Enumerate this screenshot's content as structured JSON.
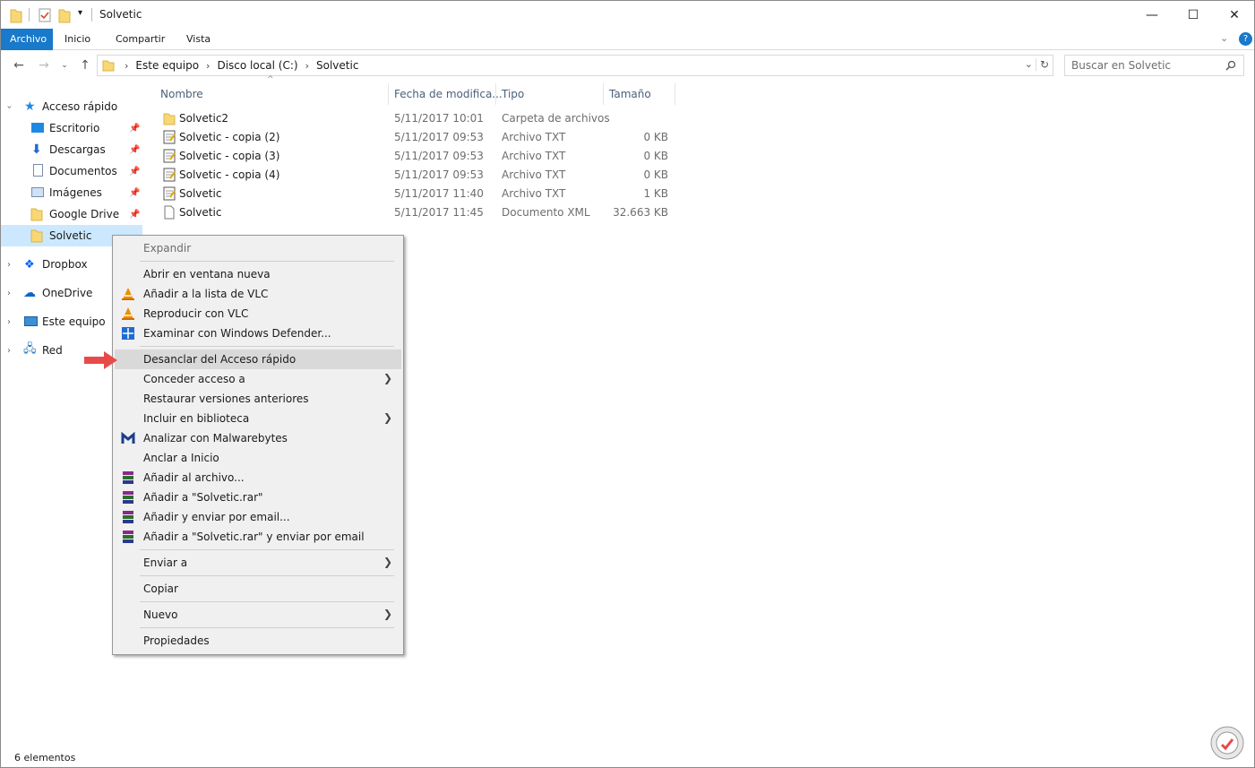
{
  "window": {
    "title": "Solvetic",
    "controls": {
      "minimize": "—",
      "maximize": "☐",
      "close": "✕"
    }
  },
  "ribbon": {
    "tabs": [
      "Archivo",
      "Inicio",
      "Compartir",
      "Vista"
    ],
    "expand_icon": "chevron-down-icon",
    "help_icon": "?"
  },
  "address": {
    "crumbs": [
      "Este equipo",
      "Disco local (C:)",
      "Solvetic"
    ],
    "search_placeholder": "Buscar en Solvetic"
  },
  "sidebar": {
    "items": [
      {
        "label": "Acceso rápido",
        "icon": "star-icon"
      },
      {
        "label": "Escritorio",
        "icon": "desktop-icon"
      },
      {
        "label": "Descargas",
        "icon": "download-icon"
      },
      {
        "label": "Documentos",
        "icon": "document-icon"
      },
      {
        "label": "Imágenes",
        "icon": "image-icon"
      },
      {
        "label": "Google Drive",
        "icon": "folder-icon"
      },
      {
        "label": "Solvetic",
        "icon": "folder-icon"
      },
      {
        "label": "Dropbox",
        "icon": "dropbox-icon"
      },
      {
        "label": "OneDrive",
        "icon": "cloud-icon"
      },
      {
        "label": "Este equipo",
        "icon": "computer-icon"
      },
      {
        "label": "Red",
        "icon": "network-icon"
      }
    ]
  },
  "columns": [
    "Nombre",
    "Fecha de modifica...",
    "Tipo",
    "Tamaño"
  ],
  "files": [
    {
      "name": "Solvetic2",
      "date": "5/11/2017 10:01",
      "type": "Carpeta de archivos",
      "size": "",
      "icon": "folder-icon"
    },
    {
      "name": "Solvetic - copia (2)",
      "date": "5/11/2017 09:53",
      "type": "Archivo TXT",
      "size": "0 KB",
      "icon": "text-file-icon"
    },
    {
      "name": "Solvetic - copia (3)",
      "date": "5/11/2017 09:53",
      "type": "Archivo TXT",
      "size": "0 KB",
      "icon": "text-file-icon"
    },
    {
      "name": "Solvetic - copia (4)",
      "date": "5/11/2017 09:53",
      "type": "Archivo TXT",
      "size": "0 KB",
      "icon": "text-file-icon"
    },
    {
      "name": "Solvetic",
      "date": "5/11/2017 11:40",
      "type": "Archivo TXT",
      "size": "1 KB",
      "icon": "text-file-icon"
    },
    {
      "name": "Solvetic",
      "date": "5/11/2017 11:45",
      "type": "Documento XML",
      "size": "32.663 KB",
      "icon": "blank-file-icon"
    }
  ],
  "context_menu": {
    "items": [
      {
        "label": "Expandir",
        "disabled": true
      },
      {
        "label": "Abrir en ventana nueva"
      },
      {
        "label": "Añadir a la lista de VLC",
        "icon": "vlc-icon"
      },
      {
        "label": "Reproducir con VLC",
        "icon": "vlc-icon"
      },
      {
        "label": "Examinar con Windows Defender...",
        "icon": "defender-icon"
      },
      {
        "label": "Desanclar del Acceso rápido",
        "highlighted": true
      },
      {
        "label": "Conceder acceso a",
        "submenu": true
      },
      {
        "label": "Restaurar versiones anteriores"
      },
      {
        "label": "Incluir en biblioteca",
        "submenu": true
      },
      {
        "label": "Analizar con Malwarebytes",
        "icon": "malwarebytes-icon"
      },
      {
        "label": "Anclar a Inicio"
      },
      {
        "label": "Añadir al archivo...",
        "icon": "winrar-icon"
      },
      {
        "label": "Añadir a \"Solvetic.rar\"",
        "icon": "winrar-icon"
      },
      {
        "label": "Añadir y enviar por email...",
        "icon": "winrar-icon"
      },
      {
        "label": "Añadir a \"Solvetic.rar\" y enviar por email",
        "icon": "winrar-icon"
      },
      {
        "label": "Enviar a",
        "submenu": true
      },
      {
        "label": "Copiar"
      },
      {
        "label": "Nuevo",
        "submenu": true
      },
      {
        "label": "Propiedades"
      }
    ]
  },
  "status": {
    "count": "6 elementos"
  },
  "colors": {
    "accent": "#1979ca",
    "selection": "#cce8ff",
    "menu_bg": "#f0f0f0",
    "pointer_arrow": "#e84a4a"
  }
}
